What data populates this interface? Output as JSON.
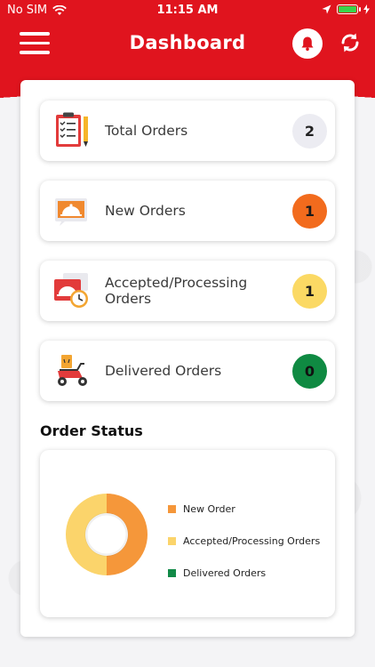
{
  "status_bar": {
    "carrier": "No SIM",
    "time": "11:15 AM"
  },
  "header": {
    "title": "Dashboard",
    "background_color": "#e0141e"
  },
  "stats": [
    {
      "label": "Total Orders",
      "count": "2",
      "icon": "clipboard-checklist-icon",
      "badge_color": "#ececf2",
      "badge_text_color": "#222222"
    },
    {
      "label": "New Orders",
      "count": "1",
      "icon": "cloche-screen-icon",
      "badge_color": "#f26b1d",
      "badge_text_color": "#1a1a1a"
    },
    {
      "label": "Accepted/Processing Orders",
      "count": "1",
      "icon": "cloche-clock-icon",
      "badge_color": "#fbd964",
      "badge_text_color": "#1a1a1a"
    },
    {
      "label": "Delivered Orders",
      "count": "0",
      "icon": "delivery-scooter-icon",
      "badge_color": "#0f8a42",
      "badge_text_color": "#111111"
    }
  ],
  "order_status": {
    "title": "Order Status"
  },
  "chart_data": {
    "type": "pie",
    "categories": [
      "New Order",
      "Accepted/Processing Orders",
      "Delivered Orders"
    ],
    "values": [
      1,
      1,
      0
    ],
    "colors": [
      "#f5973a",
      "#fbd46b",
      "#128a48"
    ],
    "donut": true,
    "legend_placement": "right"
  }
}
